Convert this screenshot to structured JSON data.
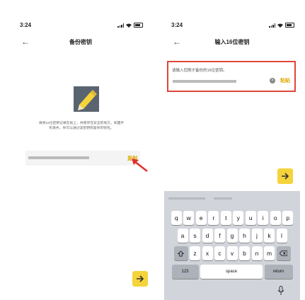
{
  "left_screen": {
    "status_time": "3:24",
    "title": "备份密钥",
    "hint_line1": "请将16位密钥记录在纸上，并保存在安全的地方。如遇手",
    "hint_line2": "机丢失，你可以通过该密钥恢复你的钱包。",
    "copy_label": "复制",
    "icons": {
      "back": "back-arrow-icon",
      "logo": "pencil-key-icon",
      "pointer": "red-arrow-pointer-icon",
      "next": "arrow-right-icon"
    }
  },
  "right_screen": {
    "status_time": "3:24",
    "title": "输入16位密钥",
    "input_label": "请输入您刚才备份的16位密钥。",
    "paste_label": "粘贴",
    "icons": {
      "clear": "clear-icon",
      "next": "arrow-right-icon",
      "mic": "mic-icon"
    }
  },
  "keyboard": {
    "row1": [
      "q",
      "w",
      "e",
      "r",
      "t",
      "y",
      "u",
      "i",
      "o",
      "p"
    ],
    "row2": [
      "a",
      "s",
      "d",
      "f",
      "g",
      "h",
      "j",
      "k",
      "l"
    ],
    "row3": [
      "z",
      "x",
      "c",
      "v",
      "b",
      "n",
      "m"
    ],
    "key_123": "123",
    "key_space": "space",
    "key_return": "return"
  },
  "colors": {
    "accent_yellow": "#f5d33a",
    "highlight_red": "#e0453a",
    "link_yellow": "#e0a800"
  }
}
